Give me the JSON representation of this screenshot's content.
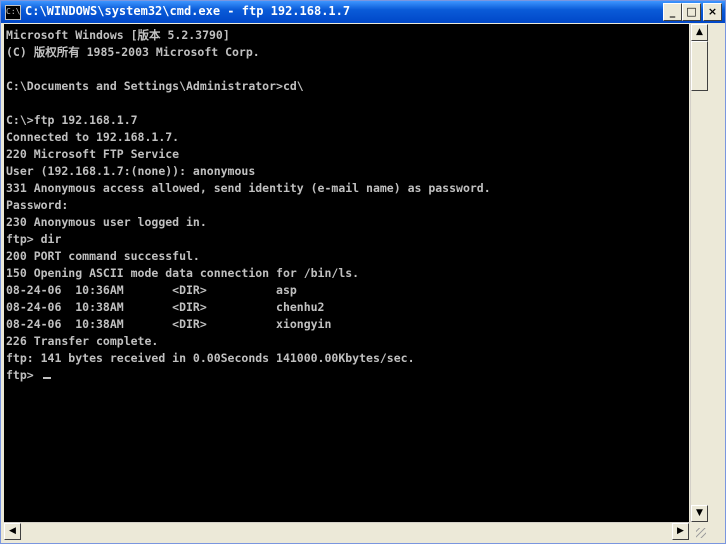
{
  "window": {
    "title": "C:\\WINDOWS\\system32\\cmd.exe - ftp 192.168.1.7",
    "icon_text": "C:\\",
    "minimize_glyph": "_",
    "maximize_glyph": "□",
    "close_glyph": "×"
  },
  "console": {
    "lines": [
      "Microsoft Windows [版本 5.2.3790]",
      "(C) 版权所有 1985-2003 Microsoft Corp.",
      "",
      "C:\\Documents and Settings\\Administrator>cd\\",
      "",
      "C:\\>ftp 192.168.1.7",
      "Connected to 192.168.1.7.",
      "220 Microsoft FTP Service",
      "User (192.168.1.7:(none)): anonymous",
      "331 Anonymous access allowed, send identity (e-mail name) as password.",
      "Password:",
      "230 Anonymous user logged in.",
      "ftp> dir",
      "200 PORT command successful.",
      "150 Opening ASCII mode data connection for /bin/ls.",
      "08-24-06  10:36AM       <DIR>          asp",
      "08-24-06  10:38AM       <DIR>          chenhu2",
      "08-24-06  10:38AM       <DIR>          xiongyin",
      "226 Transfer complete.",
      "ftp: 141 bytes received in 0.00Seconds 141000.00Kbytes/sec."
    ],
    "prompt": "ftp> "
  },
  "scrollbars": {
    "up_glyph": "▲",
    "down_glyph": "▼",
    "left_glyph": "◀",
    "right_glyph": "▶"
  },
  "colors": {
    "console_bg": "#000000",
    "console_fg": "#c0c0c0",
    "titlebar": "#0a5bd8"
  }
}
